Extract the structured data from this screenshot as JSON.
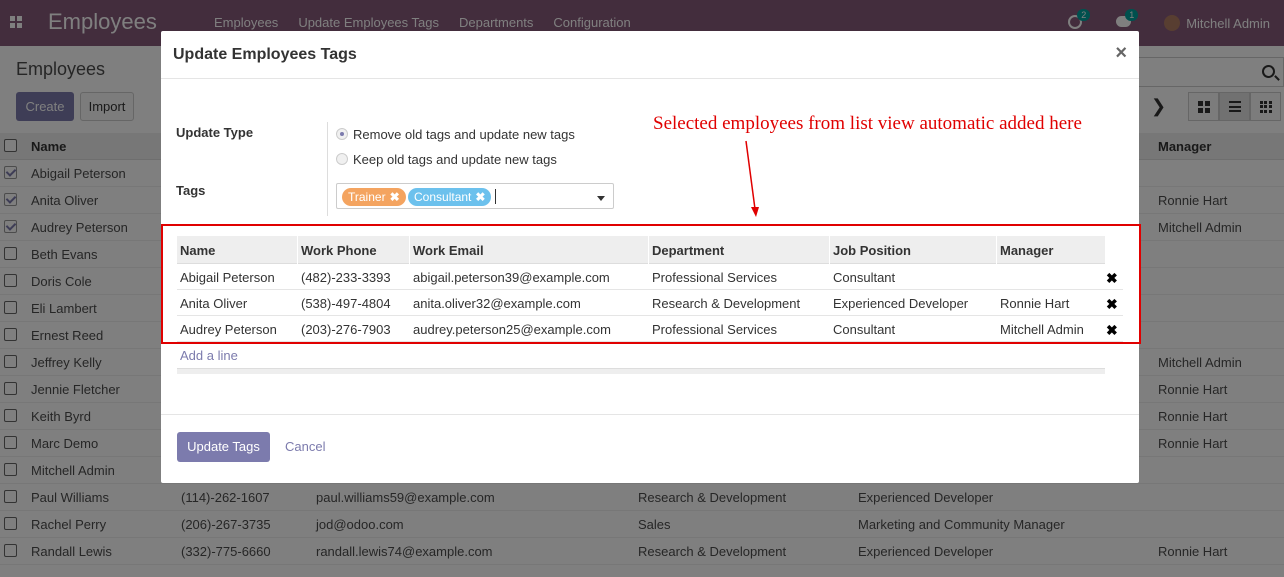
{
  "navbar": {
    "brand": "Employees",
    "menu": [
      "Employees",
      "Update Employees Tags",
      "Departments",
      "Configuration"
    ],
    "activity_badge": "2",
    "message_badge": "1",
    "user": "Mitchell Admin"
  },
  "control_panel": {
    "title": "Employees",
    "create_label": "Create",
    "import_label": "Import",
    "pager_next": "❯"
  },
  "bg_list": {
    "headers": {
      "name": "Name",
      "manager": "Manager"
    },
    "rows": [
      {
        "name": "Abigail Peterson",
        "manager": "",
        "checked": true
      },
      {
        "name": "Anita Oliver",
        "manager": "Ronnie Hart",
        "checked": true
      },
      {
        "name": "Audrey Peterson",
        "manager": "Mitchell Admin",
        "checked": true
      },
      {
        "name": "Beth Evans",
        "manager": ""
      },
      {
        "name": "Doris Cole",
        "manager": ""
      },
      {
        "name": "Eli Lambert",
        "manager": ""
      },
      {
        "name": "Ernest Reed",
        "manager": ""
      },
      {
        "name": "Jeffrey Kelly",
        "manager": "Mitchell Admin"
      },
      {
        "name": "Jennie Fletcher",
        "manager": "Ronnie Hart"
      },
      {
        "name": "Keith Byrd",
        "manager": "Ronnie Hart"
      },
      {
        "name": "Marc Demo",
        "manager": "Ronnie Hart"
      },
      {
        "name": "Mitchell Admin",
        "manager": ""
      },
      {
        "name": "Paul Williams",
        "phone": "(114)-262-1607",
        "email": "paul.williams59@example.com",
        "dept": "Research & Development",
        "job": "Experienced Developer",
        "manager": ""
      },
      {
        "name": "Rachel Perry",
        "phone": "(206)-267-3735",
        "email": "jod@odoo.com",
        "dept": "Sales",
        "job": "Marketing and Community Manager",
        "manager": ""
      },
      {
        "name": "Randall Lewis",
        "phone": "(332)-775-6660",
        "email": "randall.lewis74@example.com",
        "dept": "Research & Development",
        "job": "Experienced Developer",
        "manager": "Ronnie Hart"
      }
    ]
  },
  "modal": {
    "title": "Update Employees Tags",
    "close": "×",
    "update_type_label": "Update Type",
    "option_remove": "Remove old tags and update new tags",
    "option_keep": "Keep old tags and update new tags",
    "tags_label": "Tags",
    "tags": [
      "Trainer",
      "Consultant"
    ],
    "annotation": "Selected employees from list view automatic added here",
    "columns": [
      "Name",
      "Work Phone",
      "Work Email",
      "Department",
      "Job Position",
      "Manager"
    ],
    "rows": [
      {
        "name": "Abigail Peterson",
        "phone": "(482)-233-3393",
        "email": "abigail.peterson39@example.com",
        "dept": "Professional Services",
        "job": "Consultant",
        "manager": ""
      },
      {
        "name": "Anita Oliver",
        "phone": "(538)-497-4804",
        "email": "anita.oliver32@example.com",
        "dept": "Research & Development",
        "job": "Experienced Developer",
        "manager": "Ronnie Hart"
      },
      {
        "name": "Audrey Peterson",
        "phone": "(203)-276-7903",
        "email": "audrey.peterson25@example.com",
        "dept": "Professional Services",
        "job": "Consultant",
        "manager": "Mitchell Admin"
      }
    ],
    "add_line": "Add a line",
    "update_button": "Update Tags",
    "cancel_button": "Cancel"
  },
  "colors": {
    "navbar": "#875a7b",
    "primary": "#7c7bad",
    "annotation": "#e00000"
  }
}
